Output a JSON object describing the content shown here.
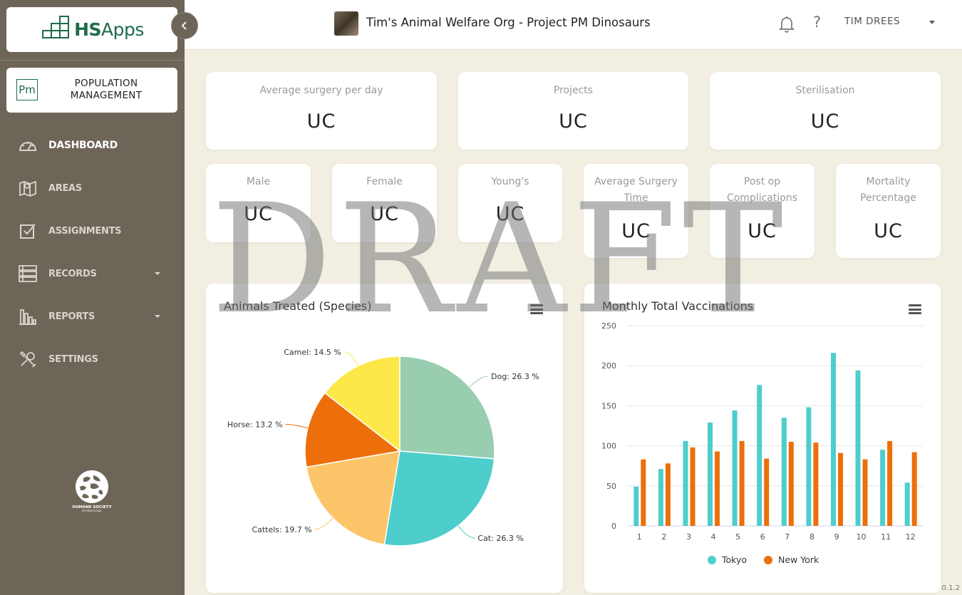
{
  "sidebar": {
    "logo": {
      "hs": "HS",
      "apps": "Apps"
    },
    "module": {
      "icon": "Pm",
      "label_line1": "POPULATION",
      "label_line2": "MANAGEMENT"
    },
    "items": [
      {
        "label": "DASHBOARD",
        "icon": "dashboard-icon",
        "active": true
      },
      {
        "label": "AREAS",
        "icon": "map-icon"
      },
      {
        "label": "ASSIGNMENTS",
        "icon": "checkbox-icon"
      },
      {
        "label": "RECORDS",
        "icon": "records-icon",
        "has_caret": true
      },
      {
        "label": "REPORTS",
        "icon": "bar-chart-icon",
        "has_caret": true
      },
      {
        "label": "SETTINGS",
        "icon": "tools-icon"
      }
    ],
    "footer_logo": {
      "line1": "HUMANE SOCIETY",
      "line2": "INTERNATIONAL"
    }
  },
  "header": {
    "org_title": "Tim's Animal Welfare Org - Project PM Dinosaurs",
    "user_name": "TIM DREES"
  },
  "stats_top": [
    {
      "label": "Average surgery per day",
      "value": "UC"
    },
    {
      "label": "Projects",
      "value": "UC"
    },
    {
      "label": "Sterilisation",
      "value": "UC"
    }
  ],
  "stats_bottom": [
    {
      "label": "Male",
      "value": "UC"
    },
    {
      "label": "Female",
      "value": "UC"
    },
    {
      "label": "Young's",
      "value": "UC"
    },
    {
      "label": "Average Surgery Time",
      "value": "UC"
    },
    {
      "label": "Post op Complications",
      "value": "UC"
    },
    {
      "label": "Mortality Percentage",
      "value": "UC"
    }
  ],
  "watermark": "DRAFT",
  "version": "0.1.2",
  "chart_data": [
    {
      "type": "pie",
      "title": "Animals Treated (Species)",
      "slices": [
        {
          "name": "Dog",
          "value": 26.3,
          "label": "Dog: 26.3 %",
          "color": "#98cdb0"
        },
        {
          "name": "Cat",
          "value": 26.3,
          "label": "Cat: 26.3 %",
          "color": "#4ecdcd"
        },
        {
          "name": "Cattels",
          "value": 19.7,
          "label": "Cattels: 19.7 %",
          "color": "#fdc56a"
        },
        {
          "name": "Horse",
          "value": 13.2,
          "label": "Horse: 13.2 %",
          "color": "#ec6f0b"
        },
        {
          "name": "Camel",
          "value": 14.5,
          "label": "Camel: 14.5 %",
          "color": "#fde84a"
        }
      ]
    },
    {
      "type": "bar",
      "title": "Monthly Total Vaccinations",
      "categories": [
        "1",
        "2",
        "3",
        "4",
        "5",
        "6",
        "7",
        "8",
        "9",
        "10",
        "11",
        "12"
      ],
      "ylim": [
        0,
        250
      ],
      "yticks": [
        "0",
        "50",
        "100",
        "150",
        "200",
        "250"
      ],
      "grid": true,
      "legend_position": "bottom",
      "series": [
        {
          "name": "Tokyo",
          "color": "#4ecdcd",
          "values": [
            49,
            71,
            106,
            129,
            144,
            176,
            135,
            148,
            216,
            194,
            95,
            54
          ]
        },
        {
          "name": "New York",
          "color": "#ec6f0b",
          "values": [
            83,
            78,
            98,
            93,
            106,
            84,
            105,
            104,
            91,
            83,
            106,
            92
          ]
        }
      ]
    }
  ]
}
